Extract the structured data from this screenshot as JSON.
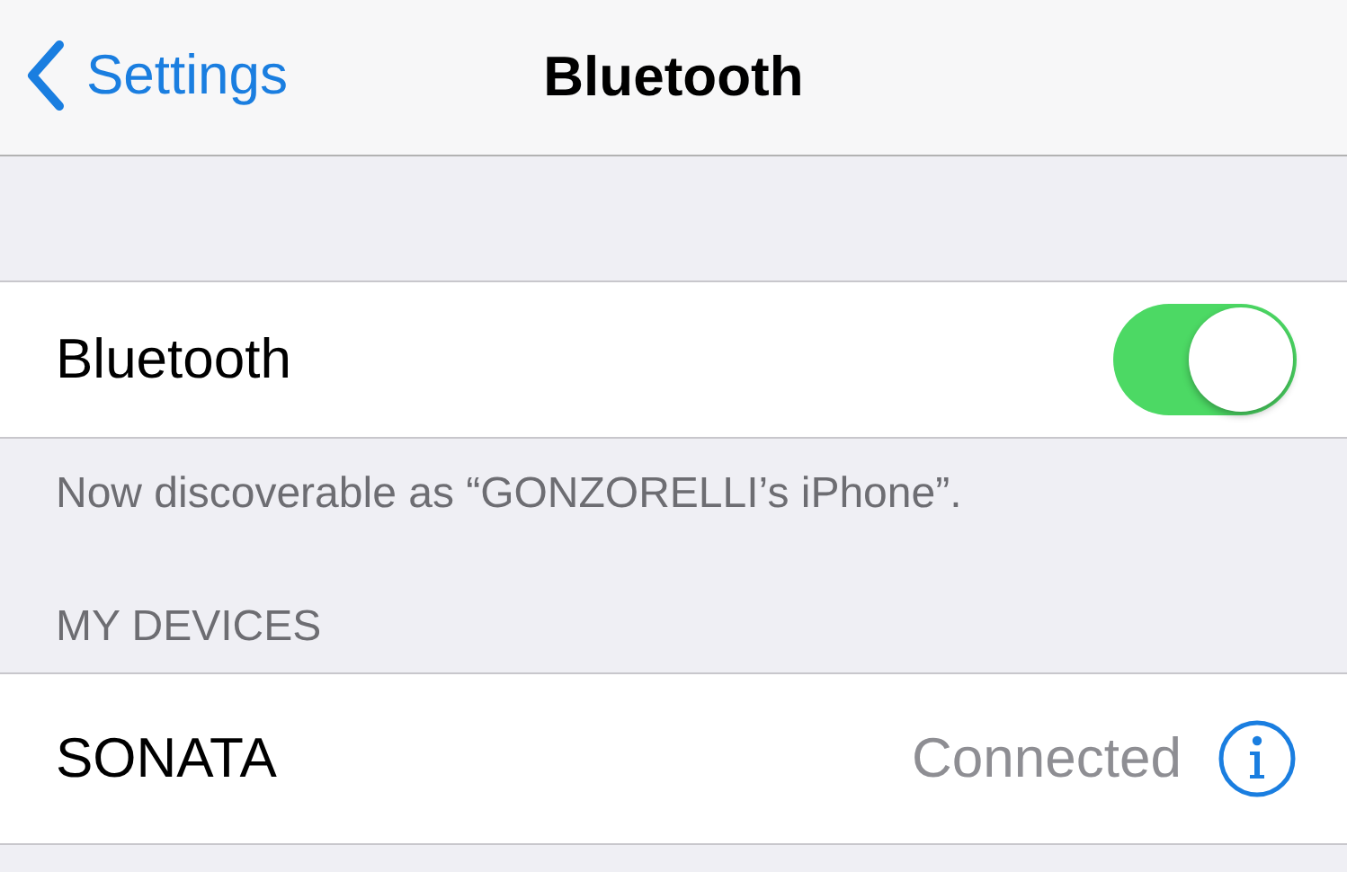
{
  "nav": {
    "back": "Settings",
    "title": "Bluetooth"
  },
  "bluetooth": {
    "label": "Bluetooth",
    "on": true
  },
  "footer": "Now discoverable as “GONZORELLI’s iPhone”.",
  "section": {
    "header": "MY DEVICES",
    "devices": [
      {
        "name": "SONATA",
        "status": "Connected"
      }
    ]
  }
}
